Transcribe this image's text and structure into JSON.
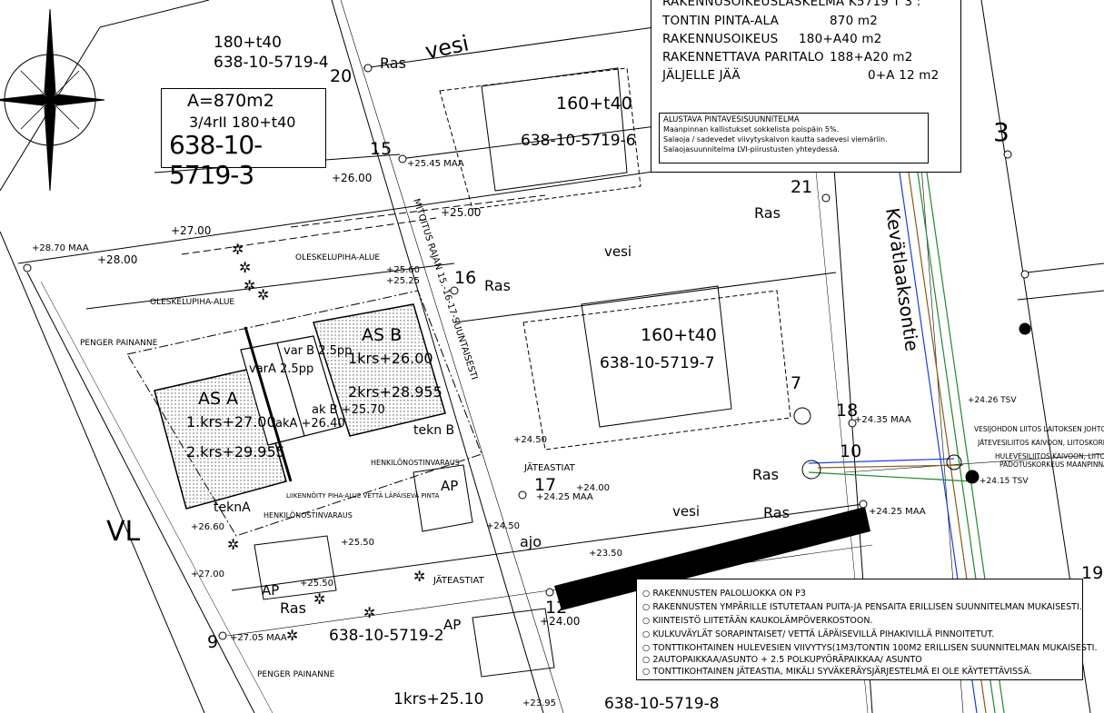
{
  "calculation": {
    "title": "RAKENNUSOIKEUSLASKELMA K5719 T 3 :",
    "rows": [
      {
        "label": "TONTIN PINTA-ALA",
        "value": "870 m2"
      },
      {
        "label": "RAKENNUSOIKEUS",
        "value": "180+A40 m2"
      },
      {
        "label": "RAKENNETTAVA PARITALO",
        "value": "188+A20 m2"
      },
      {
        "label": "JÄLJELLE JÄÄ",
        "value": "0+A 12 m2"
      }
    ]
  },
  "water_plan": {
    "title": "ALUSTAVA PINTAVESISUUNNITELMA",
    "lines": [
      "Maanpinnan kallistukset sokkelista poispäin 5%.",
      "Salaoja / sadevedet viivytyskaivon kautta sadevesi viemäriin.",
      "Salaojasuunnitelma LVI-piirustusten yhteydessä."
    ]
  },
  "notes": [
    "RAKENNUSTEN PALOLUOKKA ON P3",
    "RAKENNUSTEN YMPÄRILLE ISTUTETAAN PUITA-JA PENSAITA ERILLISEN SUUNNITELMAN MUKAISESTI.",
    "KIINTEISTÖ LIITETÄÄN KAUKOLÄMPÖVERKOSTOON.",
    "KULKUVÄYLÄT SORAPINTAISET/ VETTÄ LÄPÄISEVILLÄ PIHAKIVILLÄ PINNOITETUT.",
    "TONTTIKOHTAINEN HULEVESIEN VIIVYTYS(1M3/TONTIN 100M2 ERILLISEN SUUNNITELMAN MUKAISESTI.",
    "2AUTOPAIKKAA/ASUNTO + 2.5 POLKUPYÖRÄPAIKKAA/ ASUNTO",
    "TONTTIKOHTAINEN JÄTEASTIA, MIKÄLI SYVÄKERÄYSJÄRJESTELMÄ EI OLE KÄYTETTÄVISSÄ."
  ],
  "plot_info": {
    "area": "A=870m2",
    "floors": "3/4rII 180+t40",
    "id": "638-10-5719-3"
  },
  "plot_labels": {
    "top_left_right": "180+t40",
    "top_left_id": "638-10-5719-4",
    "right_top_right": "160+t40",
    "right_top_id": "638-10-5719-6",
    "right_mid_right": "160+t40",
    "right_mid_id": "638-10-5719-7",
    "bottom_id_left": "638-10-5719-2",
    "bottom_id_right": "638-10-5719-8",
    "bottom_floor": "1krs+25.10"
  },
  "buildings": {
    "as_a": {
      "name": "AS A",
      "f1": "1.krs+27.00",
      "f2": "2.krs+29.955"
    },
    "as_b": {
      "name": "AS B",
      "f1": "1krs+26.00",
      "f2": "2krs+28.955"
    },
    "var_a": "varA 2.5pp",
    "var_b": "var B 2.5pp",
    "ak_a": "akA +26.40",
    "ak_b": "ak B +25.70",
    "tekn_a": "teknA",
    "tekn_b": "tekn B"
  },
  "map_labels": {
    "road": "Kevätlaaksontie",
    "vl": "VL",
    "ras": "Ras",
    "vesi": "vesi",
    "ajo": "ajo",
    "ap": "AP",
    "jateastiat": "JÄTEASTIAT",
    "oleskelu": "OLESKELUPIHA-ALUE",
    "penger": "PENGER PAINANNE",
    "liikennoity": "LIIKENNÖITY PIHA-ALUE VETTÄ LÄPÄISEVÄ PINTA",
    "henkilonosto": "HENKILÖNOSTINVARAUS",
    "mitoitus": "MITOITUS RAJAN 15.-16-17-SUUNTAISESTI",
    "vesijohto": "VESIJOHDON LIITOS LAITOKSEN JOHTOON",
    "jatevesi": "JÄTEVESILIITOS KAIVOON, LIITOSKORKEUS",
    "hulevesi": "HULEVESILIITOS KAIVOON, LIITOSKORKEUS",
    "padotus": "PADOTUSKORKEUS MAANPINNAN",
    "tsv1": "+24.26 TSV",
    "tsv2": "+24.15 TSV"
  },
  "point_numbers": [
    "20",
    "15",
    "16",
    "17",
    "18",
    "10",
    "21",
    "7",
    "12",
    "9",
    "3",
    "19"
  ],
  "levels": [
    "+25.45 MAA",
    "+26.00",
    "+25.00",
    "+27.00",
    "+28.70 MAA",
    "+28.00",
    "+24.35 MAA",
    "+24.25 MAA",
    "+24.25 MAA",
    "+24.50",
    "+24.00",
    "+23.50",
    "+24.00",
    "+27.05 MAA",
    "+25.50",
    "+27.00",
    "+23.95",
    "+24.50",
    "+26.60",
    "+25.60",
    "+25.25",
    "+25.50"
  ],
  "colors": {
    "ink": "#000000",
    "blue": "#1a3fd6",
    "green": "#1e8a2a",
    "brown": "#8a5a1a",
    "gray": "#555555",
    "fill": "#bdbdbd"
  },
  "icons": [
    "north-arrow-icon",
    "tree-icon",
    "well-icon"
  ]
}
